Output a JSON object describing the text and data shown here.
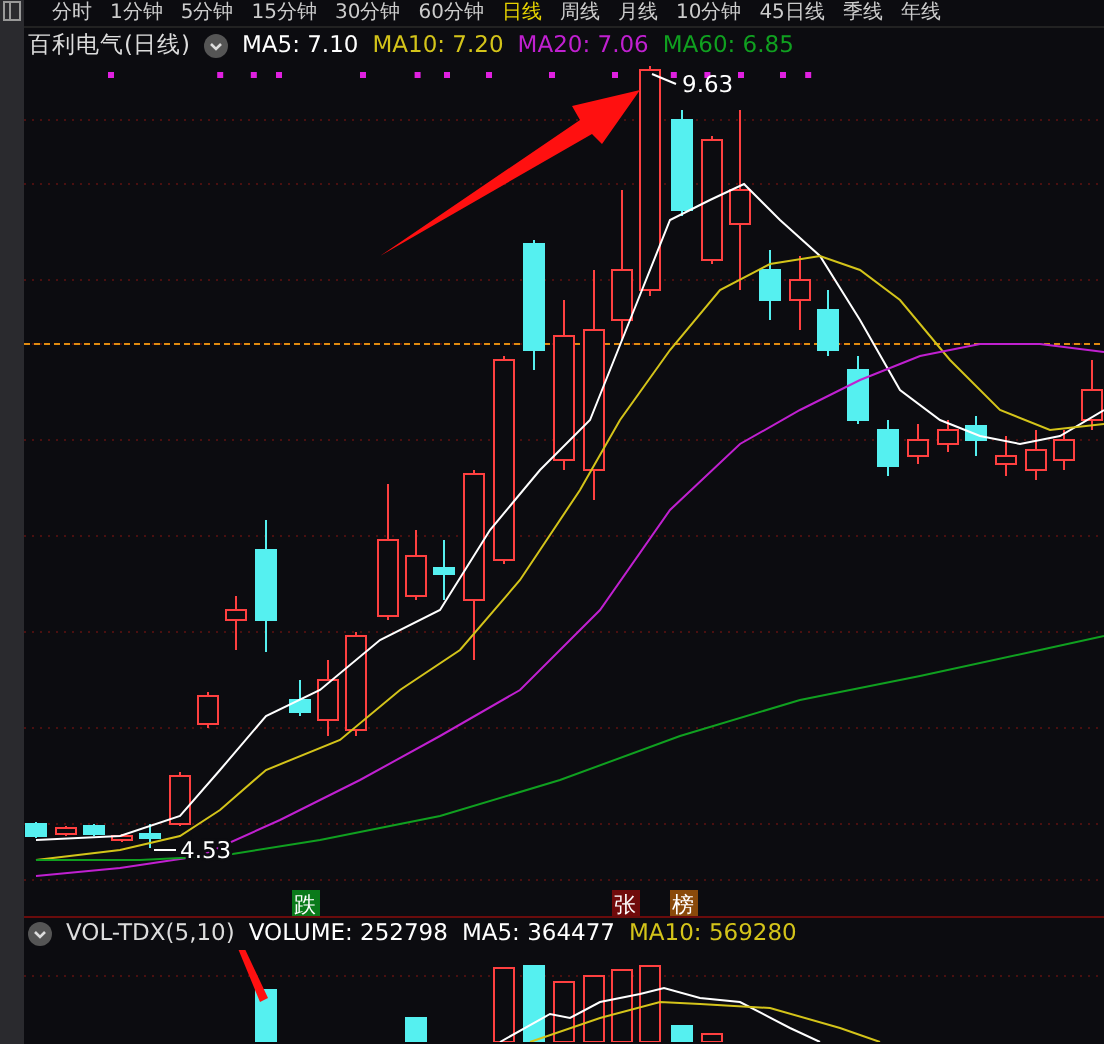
{
  "timeframe_tabs": [
    {
      "label": "分时",
      "selected": false
    },
    {
      "label": "1分钟",
      "selected": false
    },
    {
      "label": "5分钟",
      "selected": false
    },
    {
      "label": "15分钟",
      "selected": false
    },
    {
      "label": "30分钟",
      "selected": false
    },
    {
      "label": "60分钟",
      "selected": false
    },
    {
      "label": "日线",
      "selected": true
    },
    {
      "label": "周线",
      "selected": false
    },
    {
      "label": "月线",
      "selected": false
    },
    {
      "label": "10分钟",
      "selected": false
    },
    {
      "label": "45日线",
      "selected": false
    },
    {
      "label": "季线",
      "selected": false
    },
    {
      "label": "年线",
      "selected": false
    }
  ],
  "legend": {
    "title": "百利电气(日线)",
    "indicators": [
      {
        "label": "MA5: 7.10",
        "color": "#ffffff"
      },
      {
        "label": "MA10: 7.20",
        "color": "#d4c41a"
      },
      {
        "label": "MA20: 7.06",
        "color": "#c020d0"
      },
      {
        "label": "MA60: 6.85",
        "color": "#10a020"
      }
    ]
  },
  "price_labels": {
    "high": "9.63",
    "low": "4.53"
  },
  "markers": [
    {
      "label": "跌",
      "color": "#0a7a1a"
    },
    {
      "label": "张",
      "color": "#700a0a"
    },
    {
      "label": "榜",
      "color": "#8a4a0a"
    }
  ],
  "volume_legend": {
    "title": "VOL-TDX(5,10)",
    "indicators": [
      {
        "label": "VOLUME: 252798",
        "color": "#ffffff"
      },
      {
        "label": "MA5: 364477",
        "color": "#ffffff"
      },
      {
        "label": "MA10: 569280",
        "color": "#d4c41a"
      }
    ]
  }
}
